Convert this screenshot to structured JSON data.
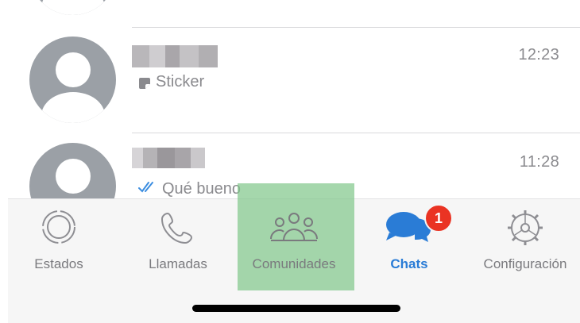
{
  "chats": [
    {
      "name": "",
      "time": "12:23",
      "preview": "Sticker",
      "preview_icon": "sticker-icon"
    },
    {
      "name": "",
      "time": "11:28",
      "preview": "Qué bueno",
      "preview_icon": "double-check-icon"
    }
  ],
  "tabs": [
    {
      "label": "Estados",
      "icon": "status-icon",
      "active": false
    },
    {
      "label": "Llamadas",
      "icon": "phone-icon",
      "active": false
    },
    {
      "label": "Comunidades",
      "icon": "communities-icon",
      "active": false,
      "highlighted": true
    },
    {
      "label": "Chats",
      "icon": "chats-icon",
      "active": true,
      "badge": "1"
    },
    {
      "label": "Configuración",
      "icon": "gear-icon",
      "active": false
    }
  ],
  "colors": {
    "accent": "#2a7cd6",
    "badge": "#ea3323",
    "highlight": "#82c88c",
    "avatar": "#9ba0a6"
  }
}
